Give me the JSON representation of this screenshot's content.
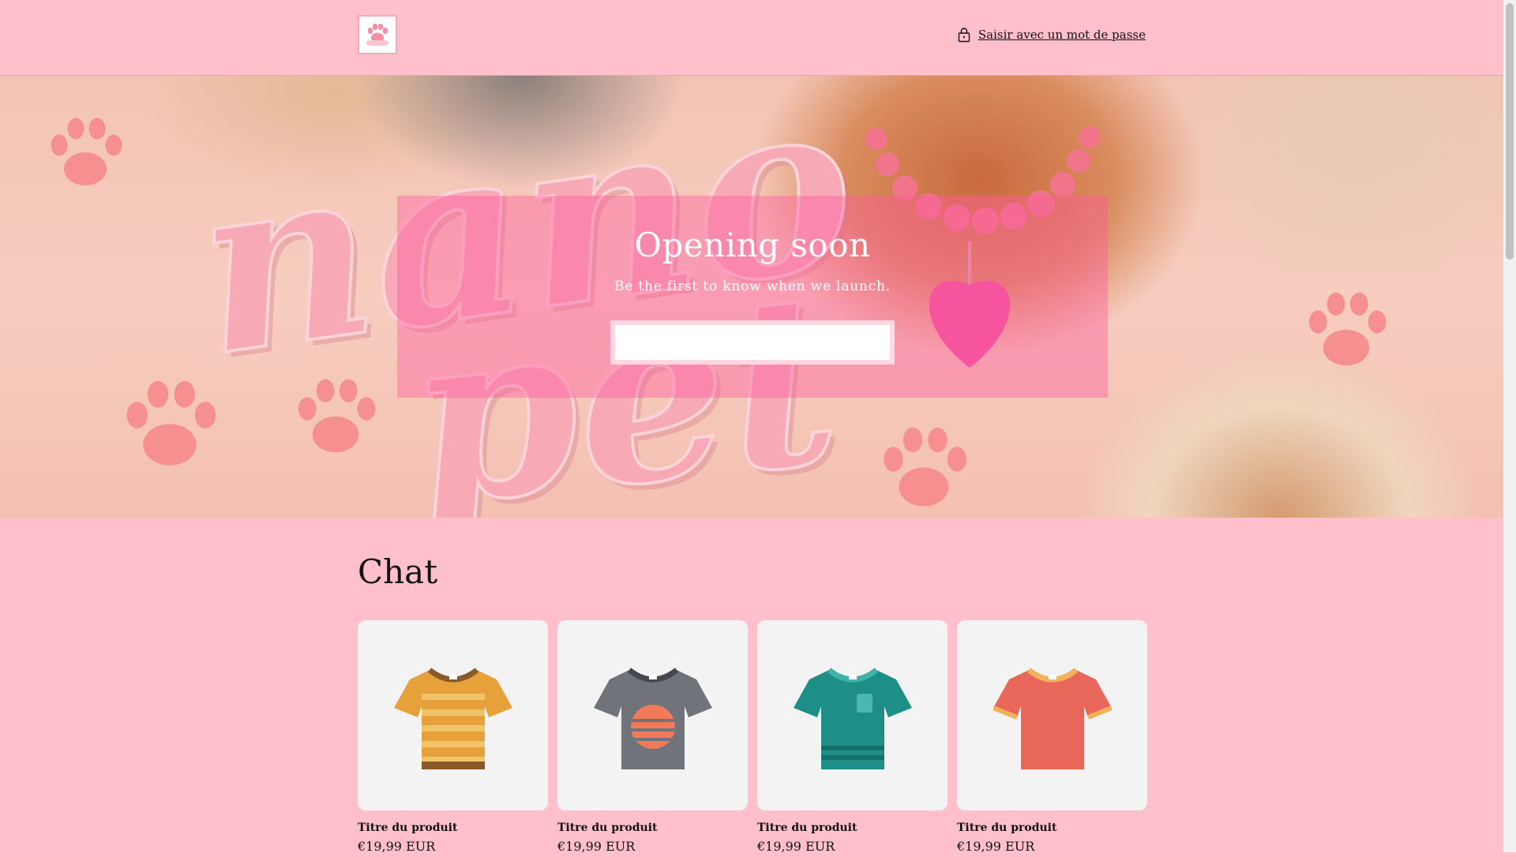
{
  "header": {
    "logo_text": "nano pet",
    "password_link_label": "Saisir avec un mot de passe"
  },
  "hero": {
    "background_word_1": "nano",
    "background_word_2": "pet",
    "title": "Opening soon",
    "subtitle": "Be the first to know when we launch.",
    "email_value": ""
  },
  "collection": {
    "title": "Chat",
    "products": [
      {
        "title": "Titre du produit",
        "price": "€19,99 EUR",
        "icon": "tshirt-yellow-striped-icon"
      },
      {
        "title": "Titre du produit",
        "price": "€19,99 EUR",
        "icon": "tshirt-gray-icon"
      },
      {
        "title": "Titre du produit",
        "price": "€19,99 EUR",
        "icon": "tshirt-teal-icon"
      },
      {
        "title": "Titre du produit",
        "price": "€19,99 EUR",
        "icon": "tshirt-coral-icon"
      }
    ]
  },
  "colors": {
    "page_background": "#ffbfcb",
    "hero_overlay": "#ff5aa0",
    "text": "#121212"
  }
}
